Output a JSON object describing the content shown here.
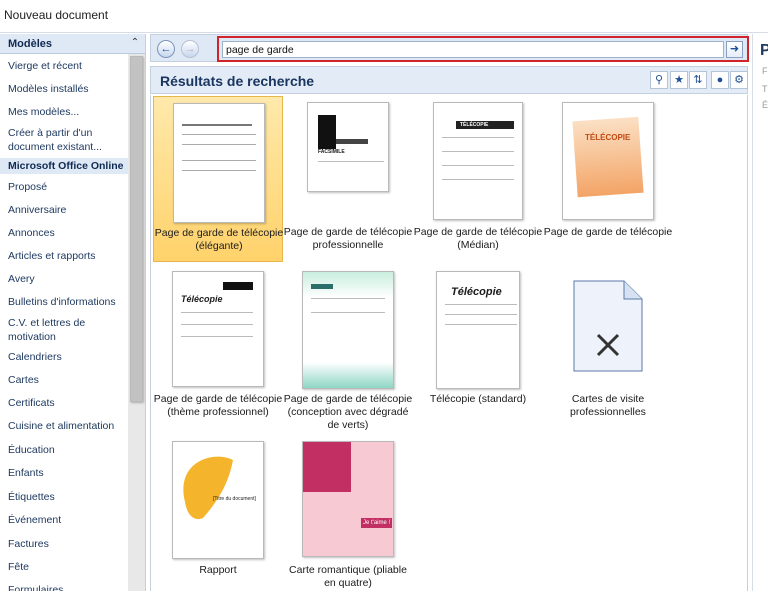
{
  "window": {
    "title": "Nouveau document"
  },
  "sidebar": {
    "header": "Modèles",
    "items": [
      {
        "label": "Vierge et récent",
        "group": false
      },
      {
        "label": "Modèles installés",
        "group": false
      },
      {
        "label": "Mes modèles...",
        "group": false
      },
      {
        "label": "Créer à partir d'un document existant...",
        "group": false
      },
      {
        "label": "Microsoft Office Online",
        "group": true
      },
      {
        "label": "Proposé",
        "group": false
      },
      {
        "label": "Anniversaire",
        "group": false
      },
      {
        "label": "Annonces",
        "group": false
      },
      {
        "label": "Articles et rapports",
        "group": false
      },
      {
        "label": "Avery",
        "group": false
      },
      {
        "label": "Bulletins d'informations",
        "group": false
      },
      {
        "label": "C.V. et lettres de motivation",
        "group": false
      },
      {
        "label": "Calendriers",
        "group": false
      },
      {
        "label": "Cartes",
        "group": false
      },
      {
        "label": "Certificats",
        "group": false
      },
      {
        "label": "Cuisine et alimentation",
        "group": false
      },
      {
        "label": "Éducation",
        "group": false
      },
      {
        "label": "Enfants",
        "group": false
      },
      {
        "label": "Étiquettes",
        "group": false
      },
      {
        "label": "Événement",
        "group": false
      },
      {
        "label": "Factures",
        "group": false
      },
      {
        "label": "Fête",
        "group": false
      },
      {
        "label": "Formulaires",
        "group": false
      }
    ]
  },
  "search": {
    "value": "page de garde"
  },
  "results": {
    "title": "Résultats de recherche",
    "templates": [
      {
        "caption": "Page de garde de télécopie (élégante)",
        "selected": true,
        "thumb_text": ""
      },
      {
        "caption": "Page de garde de télécopie professionnelle",
        "selected": false,
        "thumb_text": "FACSIMILE"
      },
      {
        "caption": "Page de garde de télécopie (Médian)",
        "selected": false,
        "thumb_text": "TÉLÉCOPIE"
      },
      {
        "caption": "Page de garde de télécopie",
        "selected": false,
        "thumb_text": "TÉLÉCOPIE"
      },
      {
        "caption": "Page de garde de télécopie (thème professionnel)",
        "selected": false,
        "thumb_text": "Télécopie"
      },
      {
        "caption": "Page de garde de télécopie (conception avec dégradé de verts)",
        "selected": false,
        "thumb_text": ""
      },
      {
        "caption": "Télécopie (standard)",
        "selected": false,
        "thumb_text": "Télécopie"
      },
      {
        "caption": "Cartes de visite professionnelles",
        "selected": false,
        "thumb_text": ""
      },
      {
        "caption": "Rapport",
        "selected": false,
        "thumb_text": "[Titre du document]"
      },
      {
        "caption": "Carte romantique (pliable en quatre)",
        "selected": false,
        "thumb_text": "Je t'aime !"
      }
    ]
  },
  "icons": {
    "back": "arrow-left-icon",
    "forward": "arrow-right-icon",
    "go": "go-arrow-icon",
    "collapse": "chevron-up-icon"
  },
  "colors": {
    "accent": "#d1232a",
    "header_bg": "#dfe8f5",
    "selection": "#ffd26b"
  }
}
